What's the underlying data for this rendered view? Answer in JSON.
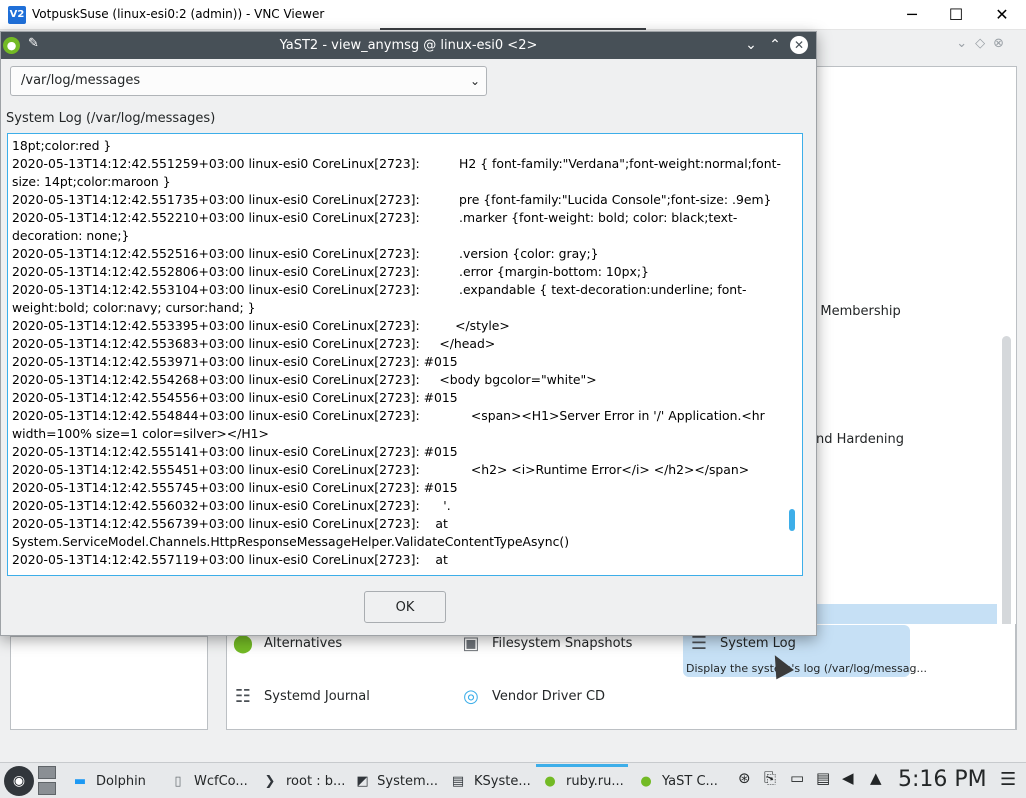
{
  "vnc": {
    "title": "VotpuskSuse (linux-esi0:2 (admin)) - VNC Viewer",
    "logo": "V2",
    "minimize": "─",
    "maximize": "☐",
    "close": "✕"
  },
  "background": {
    "partial_labels": {
      "membership": "n Membership",
      "hardening": "and Hardening"
    },
    "modules": [
      {
        "label": "Alternatives",
        "icon": "alternatives-icon"
      },
      {
        "label": "Filesystem Snapshots",
        "icon": "snapshots-icon"
      },
      {
        "label": "System Log",
        "icon": "system-log-icon"
      },
      {
        "label": "Systemd Journal",
        "icon": "journal-icon"
      },
      {
        "label": "Vendor Driver CD",
        "icon": "cd-icon"
      }
    ],
    "selected_desc": "Display the system's log (/var/log/messag..."
  },
  "dialog": {
    "title": "YaST2 - view_anymsg @ linux-esi0 <2>",
    "buttons": {
      "minimize": "⌄",
      "maximize": "⌃",
      "close": "✕"
    },
    "combo_value": "/var/log/messages",
    "log_label": "System Log (/var/log/messages)",
    "log_lines": [
      "18pt;color:red }",
      "2020-05-13T14:12:42.551259+03:00 linux-esi0 CoreLinux[2723]:          H2 { font-family:\"Verdana\";font-weight:normal;font-size: 14pt;color:maroon }",
      "2020-05-13T14:12:42.551735+03:00 linux-esi0 CoreLinux[2723]:          pre {font-family:\"Lucida Console\";font-size: .9em}",
      "2020-05-13T14:12:42.552210+03:00 linux-esi0 CoreLinux[2723]:          .marker {font-weight: bold; color: black;text-decoration: none;}",
      "2020-05-13T14:12:42.552516+03:00 linux-esi0 CoreLinux[2723]:          .version {color: gray;}",
      "2020-05-13T14:12:42.552806+03:00 linux-esi0 CoreLinux[2723]:          .error {margin-bottom: 10px;}",
      "2020-05-13T14:12:42.553104+03:00 linux-esi0 CoreLinux[2723]:          .expandable { text-decoration:underline; font-weight:bold; color:navy; cursor:hand; }",
      "2020-05-13T14:12:42.553395+03:00 linux-esi0 CoreLinux[2723]:         </style>",
      "2020-05-13T14:12:42.553683+03:00 linux-esi0 CoreLinux[2723]:     </head>",
      "2020-05-13T14:12:42.553971+03:00 linux-esi0 CoreLinux[2723]: #015",
      "2020-05-13T14:12:42.554268+03:00 linux-esi0 CoreLinux[2723]:     <body bgcolor=\"white\">",
      "2020-05-13T14:12:42.554556+03:00 linux-esi0 CoreLinux[2723]: #015",
      "2020-05-13T14:12:42.554844+03:00 linux-esi0 CoreLinux[2723]:             <span><H1>Server Error in '/' Application.<hr width=100% size=1 color=silver></H1>",
      "2020-05-13T14:12:42.555141+03:00 linux-esi0 CoreLinux[2723]: #015",
      "2020-05-13T14:12:42.555451+03:00 linux-esi0 CoreLinux[2723]:             <h2> <i>Runtime Error</i> </h2></span>",
      "2020-05-13T14:12:42.555745+03:00 linux-esi0 CoreLinux[2723]: #015",
      "2020-05-13T14:12:42.556032+03:00 linux-esi0 CoreLinux[2723]:      '.",
      "2020-05-13T14:12:42.556739+03:00 linux-esi0 CoreLinux[2723]:    at System.ServiceModel.Channels.HttpResponseMessageHelper.ValidateContentTypeAsync()",
      "2020-05-13T14:12:42.557119+03:00 linux-esi0 CoreLinux[2723]:    at"
    ],
    "ok_label": "OK"
  },
  "taskbar": {
    "tasks": [
      {
        "label": "Dolphin",
        "icon": "folder-icon"
      },
      {
        "label": "WcfCo...",
        "icon": "document-icon"
      },
      {
        "label": "root : b...",
        "icon": "terminal-icon"
      },
      {
        "label": "System...",
        "icon": "monitor-icon"
      },
      {
        "label": "KSyste...",
        "icon": "ksysguard-icon"
      },
      {
        "label": "ruby.ru...",
        "icon": "yast-icon"
      },
      {
        "label": "YaST C...",
        "icon": "yast-icon"
      }
    ],
    "clock": "5:16 PM"
  },
  "colors": {
    "accent": "#3daee9",
    "titlebar": "#475057",
    "selection": "#c6e0f5",
    "suse_green": "#73ba25"
  }
}
